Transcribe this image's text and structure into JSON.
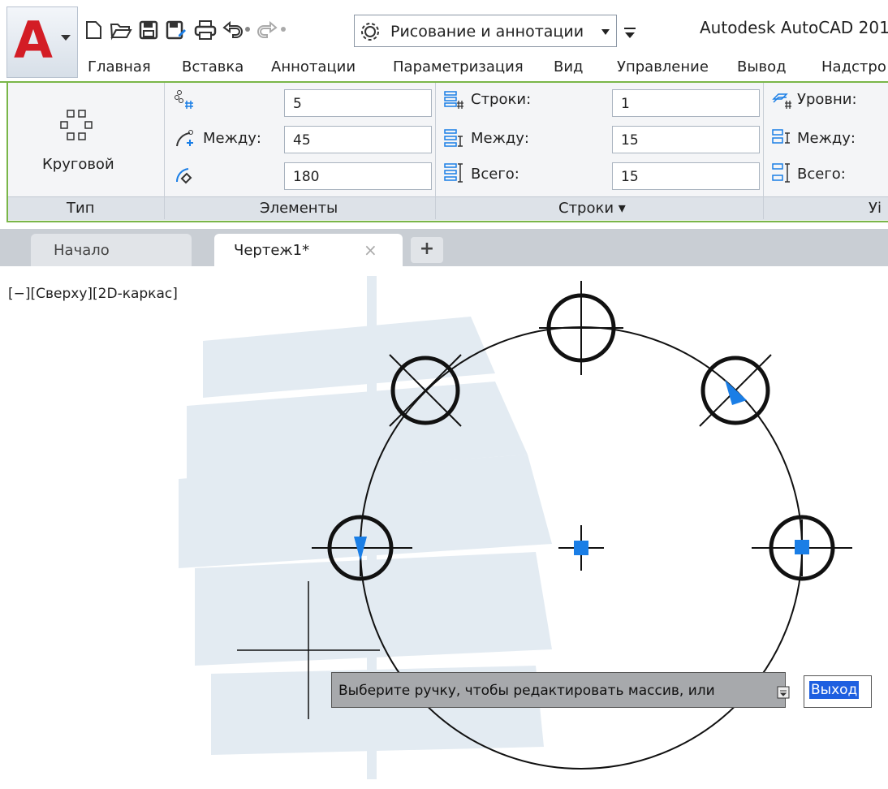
{
  "app": {
    "title": "Autodesk AutoCAD 201",
    "logo_letter": "A",
    "workspace": "Рисование и аннотации"
  },
  "quick_access": {
    "icons": [
      "new-file-icon",
      "open-file-icon",
      "save-icon",
      "save-as-icon",
      "print-icon",
      "undo-icon",
      "redo-icon"
    ]
  },
  "ribbon_tabs": [
    "Главная",
    "Вставка",
    "Аннотации",
    "Параметризация",
    "Вид",
    "Управление",
    "Вывод",
    "Надстро"
  ],
  "ribbon": {
    "type_panel": {
      "button_label": "Круговой",
      "title": "Тип"
    },
    "items_panel": {
      "title": "Элементы",
      "count_value": "5",
      "between_label": "Между:",
      "between_value": "45",
      "fill_value": "180"
    },
    "rows_panel": {
      "title": "Строки ▾",
      "rows_label": "Строки:",
      "rows_value": "1",
      "between_label": "Между:",
      "between_value": "15",
      "total_label": "Всего:",
      "total_value": "15"
    },
    "levels_panel": {
      "title": "Уі",
      "levels_label": "Уровни:",
      "between_label": "Между:",
      "total_label": "Всего:"
    }
  },
  "file_tabs": {
    "start": "Начало",
    "drawing": "Чертеж1*",
    "close": "×",
    "add": "+"
  },
  "viewport": {
    "label": "[−][Сверху][2D-каркас]"
  },
  "command": {
    "prompt": "Выберите ручку, чтобы редактировать массив, или",
    "option": "Выход"
  },
  "colors": {
    "accent_green": "#7ab648",
    "grip_blue": "#1a7ee6",
    "logo_red": "#d31d25"
  }
}
